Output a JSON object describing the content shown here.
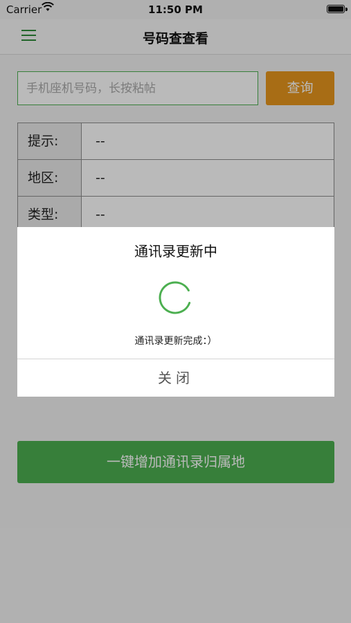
{
  "status_bar": {
    "carrier": "Carrier",
    "time": "11:50 PM"
  },
  "nav": {
    "title": "号码查查看",
    "menu_icon": "hamburger-menu-icon"
  },
  "search": {
    "placeholder": "手机座机号码，长按粘帖",
    "value": "",
    "button_label": "查询"
  },
  "info_table": {
    "rows": [
      {
        "label": "提示:",
        "value": "--"
      },
      {
        "label": "地区:",
        "value": "--"
      },
      {
        "label": "类型:",
        "value": "--"
      }
    ]
  },
  "action": {
    "add_label": "一键增加通讯录归属地"
  },
  "modal": {
    "title": "通讯录更新中",
    "message": "通讯录更新完成：）",
    "close_label": "关闭",
    "spinner_icon": "loading-spinner-icon"
  },
  "colors": {
    "accent_green": "#4caf50",
    "query_orange": "#e7961d",
    "menu_green": "#2e8b3a"
  }
}
